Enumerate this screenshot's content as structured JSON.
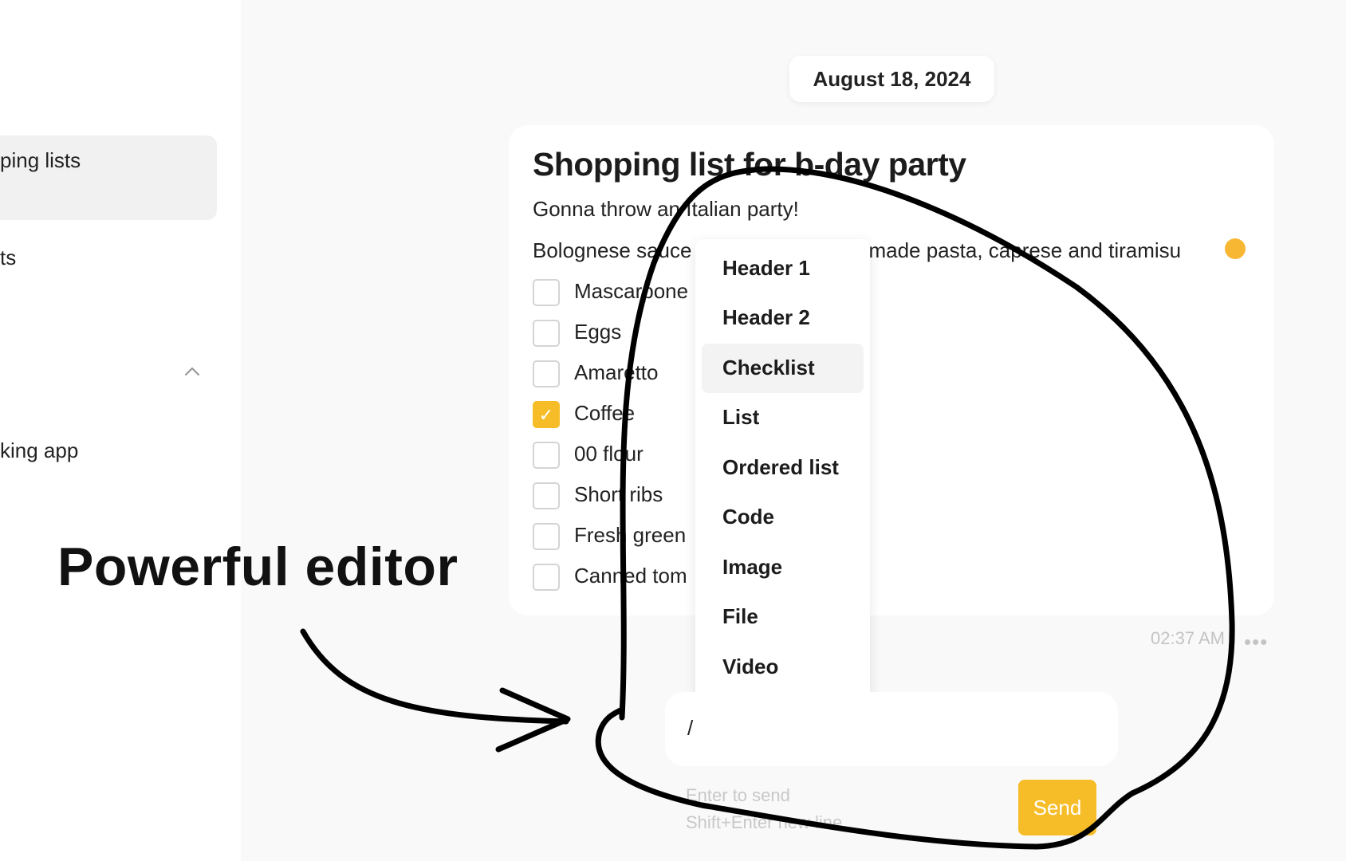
{
  "sidebar": {
    "items": [
      {
        "label": "ping lists"
      },
      {
        "label": "ts"
      },
      {
        "label": "king app"
      }
    ]
  },
  "note": {
    "date": "August 18, 2024",
    "title": "Shopping list for b-day party",
    "subtitle": "Gonna throw an Italian party!",
    "line_left": "Bolognese sauce",
    "line_right": "emade pasta, caprese and tiramisu",
    "checklist": [
      {
        "label": "Mascarpone",
        "checked": false
      },
      {
        "label": "Eggs",
        "checked": false
      },
      {
        "label": "Amaretto",
        "checked": false
      },
      {
        "label": "Coffee",
        "checked": true
      },
      {
        "label": "00 flour",
        "checked": false
      },
      {
        "label": "Short ribs",
        "checked": false
      },
      {
        "label": "Fresh green",
        "checked": false
      },
      {
        "label": "Canned tom",
        "checked": false
      }
    ],
    "time": "02:37 AM",
    "more": "•••"
  },
  "menu": {
    "items": [
      "Header 1",
      "Header 2",
      "Checklist",
      "List",
      "Ordered list",
      "Code",
      "Image",
      "File",
      "Video"
    ],
    "highlighted": "Checklist"
  },
  "composer": {
    "value": "/",
    "hint_send": "Enter to send",
    "hint_newline": "Shift+Enter new line",
    "send_label": "Send"
  },
  "promo": {
    "text": "Powerful editor"
  },
  "colors": {
    "accent": "#f6bd28"
  }
}
